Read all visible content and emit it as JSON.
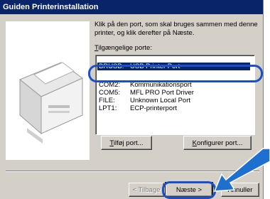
{
  "window": {
    "title": "Guiden Printerinstallation"
  },
  "instruction": "Klik på den port, som skal bruges sammen med denne printer, og klik derefter på Næste.",
  "ports_label": "Tilgængelige porte:",
  "ports": [
    {
      "port": "",
      "description": ""
    },
    {
      "port": "BRUSB:",
      "description": "USB Printer Port"
    },
    {
      "port": "",
      "description": ""
    },
    {
      "port": "COM2:",
      "description": "Kommunikationsport"
    },
    {
      "port": "COM5:",
      "description": "MFL PRO Port Driver"
    },
    {
      "port": "FILE:",
      "description": "Unknown Local Port"
    },
    {
      "port": "LPT1:",
      "description": "ECP-printerport"
    }
  ],
  "buttons": {
    "add_port": "Tilføj port...",
    "configure_port": "Konfigurer port...",
    "back": "< Tilbage",
    "next": "Næste >",
    "cancel": "Annuller"
  },
  "colors": {
    "titlebar": "#0a246a",
    "selection": "#0a246a",
    "callout": "#1a4fc8",
    "arrow": "#1f6fd0"
  }
}
